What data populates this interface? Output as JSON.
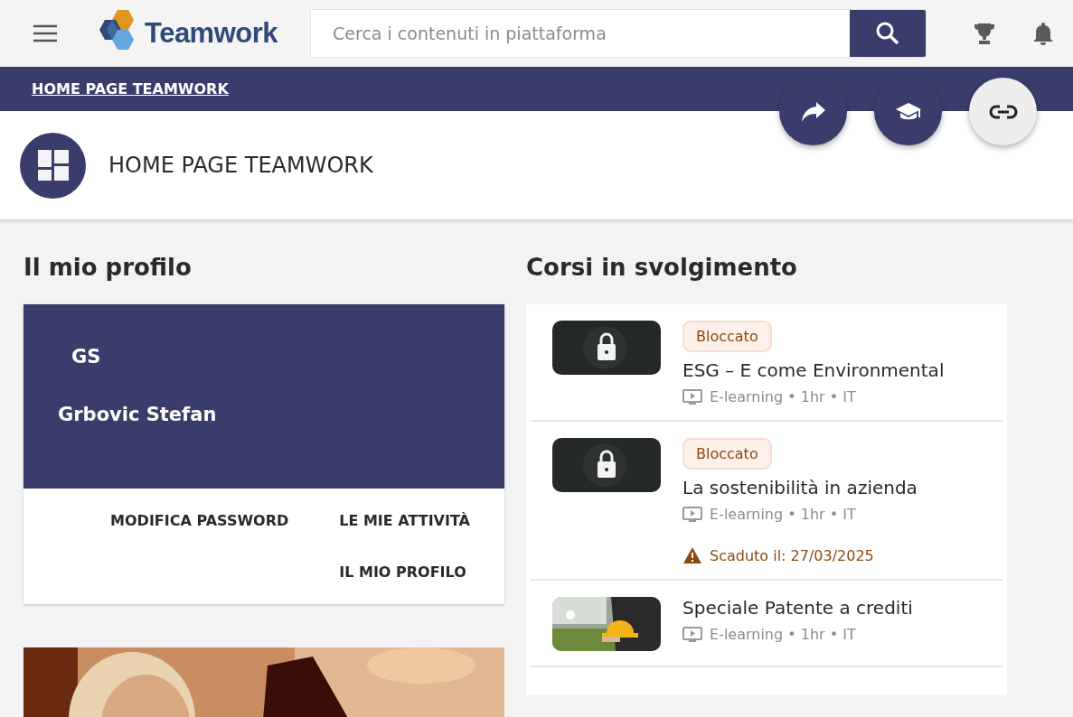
{
  "header": {
    "logo_text": "Teamwork",
    "search": {
      "placeholder": "Cerca i contenuti in piattaforma"
    }
  },
  "breadcrumb": "HOME PAGE TEAMWORK",
  "page_title": "HOME PAGE TEAMWORK",
  "profile": {
    "heading": "Il mio profilo",
    "initials": "GS",
    "name": "Grbovic Stefan",
    "links": [
      "MODIFICA PASSWORD",
      "LE MIE ATTIVITÀ",
      "IL MIO PROFILO"
    ]
  },
  "courses": {
    "heading": "Corsi in svolgimento",
    "items": [
      {
        "kind": "locked",
        "badge": "Bloccato",
        "title": "ESG – E come Environmental",
        "meta": "E-learning • 1hr • IT"
      },
      {
        "kind": "locked",
        "badge": "Bloccato",
        "title": "La sostenibilità in azienda",
        "meta": "E-learning • 1hr • IT",
        "warning": "Scaduto il: 27/03/2025"
      },
      {
        "kind": "picture",
        "title": "Speciale Patente a crediti",
        "meta": "E-learning • 1hr • IT"
      }
    ]
  }
}
